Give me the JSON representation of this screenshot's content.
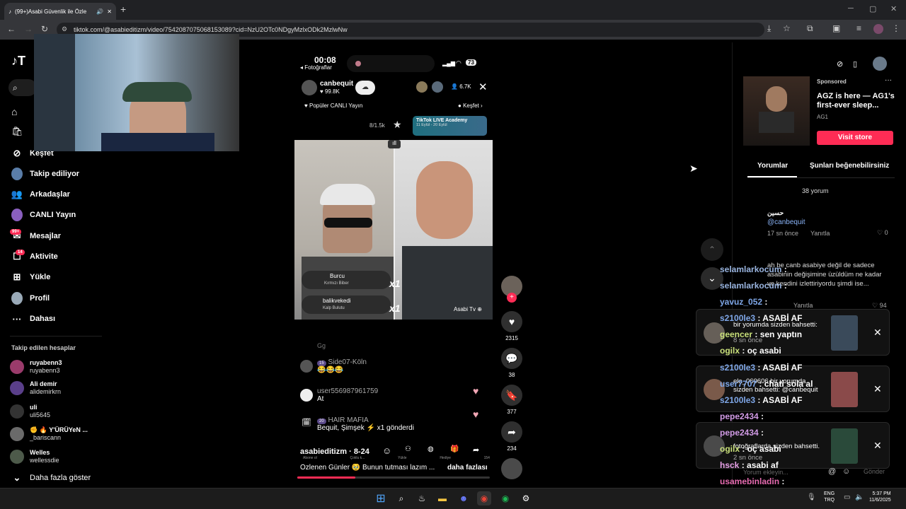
{
  "browser": {
    "tab_title": "(99+)Asabi Güvenlik ile Özle",
    "url": "tiktok.com/@asabieditizm/video/7542087075068153089?cid=NzU2OTc0NDgyMzlxODk2MzlwNw"
  },
  "sidebar": {
    "logo": "T",
    "items": [
      {
        "label": "Keşfet"
      },
      {
        "label": "Takip ediliyor"
      },
      {
        "label": "Arkadaşlar"
      },
      {
        "label": "CANLI Yayın"
      },
      {
        "label": "Mesajlar",
        "badge": "99+"
      },
      {
        "label": "Aktivite",
        "badge": "14"
      },
      {
        "label": "Yükle"
      },
      {
        "label": "Profil"
      },
      {
        "label": "Dahası"
      }
    ],
    "following_title": "Takip edilen hesaplar",
    "accounts": [
      {
        "name": "ruyabenn3",
        "user": "ruyabenn3"
      },
      {
        "name": "Ali demir",
        "user": "alidemirkrn"
      },
      {
        "name": "uli",
        "user": "uli5645"
      },
      {
        "name": "✊ 🔥 Y'ÜRÜYeN ...",
        "user": "_bariscann"
      },
      {
        "name": "Welles",
        "user": "wellessdie"
      }
    ],
    "show_more": "Daha fazla göster"
  },
  "phone": {
    "time": "00:08",
    "back_label": "◂ Fotoğraflar",
    "battery": "73",
    "host_name": "canbequit",
    "host_likes": "99.8K",
    "viewers": "6.7K",
    "popular_label": "Popüler CANLI Yayın",
    "discover_label": "Keşfet",
    "rank": "8/1.5k",
    "academy_title": "TikTok LIVE Academy",
    "academy_dates": "11 Eylül - 20 Eylül",
    "guest1": "Burcu",
    "guest1_sub": "Kırmızı Biber",
    "guest2": "balikvekedi",
    "guest2_sub": "Kalp Bulutu",
    "mult1": "x1",
    "mult2": "x1",
    "right_name": "Asabi Tv",
    "chat": [
      {
        "user": "Gg",
        "text": ""
      },
      {
        "level": "15",
        "user": "Side07-Köln",
        "text": "😂😂😂"
      },
      {
        "user": "user556987961759",
        "text": "At"
      },
      {
        "level": "20",
        "user": "HAIR MAFIA",
        "text": "Bequit, Şimşek ⚡ x1 gönderdi"
      }
    ],
    "bottom_user": "asabieditizm",
    "bottom_time": "8-24",
    "bottom_labels": [
      "Abone ol",
      "Çoklu k...",
      "Yükle",
      "Hediye",
      "154"
    ],
    "caption": "Özlenen Günler 🥹 Bunun tutması lazım ...",
    "more": "daha fazlası"
  },
  "actions": {
    "likes": "2315",
    "comments": "38",
    "saves": "377",
    "shares": "234"
  },
  "right": {
    "sponsored": "Sponsored",
    "ad_title": "AGZ is here — AG1's first-ever sleep...",
    "ad_brand": "AG1",
    "visit_store": "Visit store",
    "tab_comments": "Yorumlar",
    "tab_like": "Şunları beğenebilirsiniz",
    "comment_count": "38 yorum",
    "first_comment_name": "حسين",
    "first_comment_text": "@canbequit",
    "first_comment_time": "17 sn önce",
    "reply": "Yanıtla",
    "first_comment_likes": "0",
    "second_comment": "ah be canb asabiye değil de sadece asabinin değişimine üzüldüm ne kadar ve kendini izlettiriyordu şimdi ise...",
    "second_comment_likes": "94"
  },
  "stream_chat": [
    {
      "user": "selamlarkocum",
      "text": "",
      "color": "#9ab5e0"
    },
    {
      "user": "selamlarkocum",
      "text": "",
      "color": "#9ab5e0"
    },
    {
      "user": "yavuz_052",
      "text": "",
      "color": "#7fa7e8"
    },
    {
      "user": "s2100le3",
      "text": "ASABİ AF",
      "color": "#7fa7e8"
    },
    {
      "user": "geencer",
      "text": "sen yaptın",
      "color": "#c9e07a"
    },
    {
      "user": "ogilx",
      "text": "oç asabi",
      "color": "#c9e07a"
    },
    {
      "user": "s2100le3",
      "text": "ASABİ AF",
      "color": "#7fa7e8"
    },
    {
      "user": "user7707",
      "text": "chati sola al",
      "color": "#7fa7e8"
    },
    {
      "user": "s2100le3",
      "text": "ASABİ AF",
      "color": "#7fa7e8"
    },
    {
      "user": "pepe2434",
      "text": "",
      "color": "#d29be6"
    },
    {
      "user": "pepe2434",
      "text": "",
      "color": "#d29be6"
    },
    {
      "user": "ogilx",
      "text": "oç asabi",
      "color": "#c9e07a"
    },
    {
      "user": "hsck",
      "text": "asabi af",
      "color": "#e6a0e6"
    },
    {
      "user": "usamebinladin",
      "text": "",
      "color": "#e66bb0"
    },
    {
      "user": "s2100le3",
      "text": "ASABİ AF",
      "color": "#7fa7e8"
    }
  ],
  "notifications": [
    {
      "text": "bir yorumda sizden bahsetti:",
      "sub": "8 sn önce"
    },
    {
      "text": "ela_060606 bir yorumda sizden bahsetti: @canbequit",
      "sub": ""
    },
    {
      "text": "fotoğraflarda sizden bahsetti.",
      "sub": "2 sn önce"
    }
  ],
  "comment_input": {
    "placeholder": "Yorum ekleyin...",
    "send": "Gönder"
  },
  "taskbar": {
    "lang1": "ENG",
    "lang2": "TRQ",
    "time": "5:37 PM",
    "date": "11/6/2025"
  },
  "colors": {
    "accent": "#fe2c55",
    "teal": "#25f4ee"
  }
}
